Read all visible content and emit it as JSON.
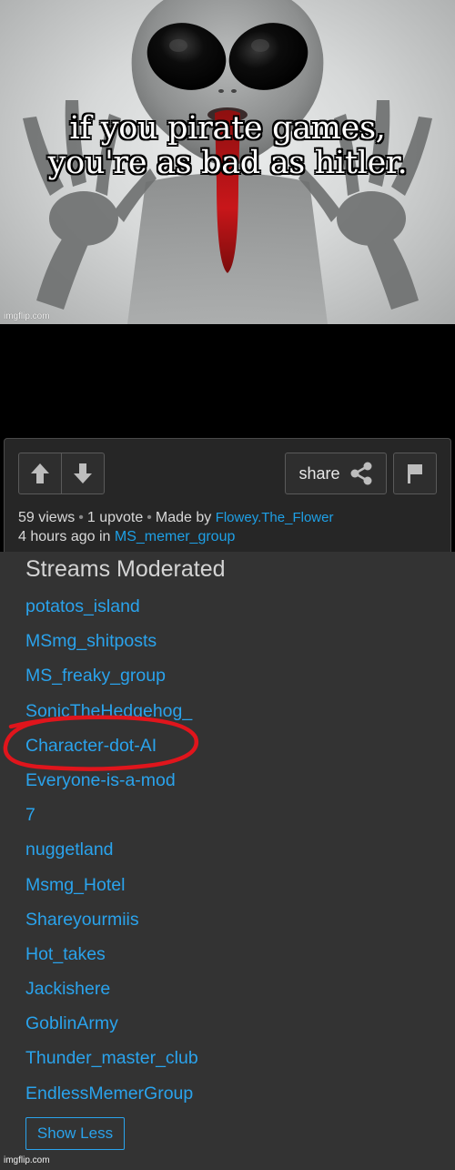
{
  "meme": {
    "caption_line1": "if you pirate games,",
    "caption_line2": "you're as bad as hitler.",
    "watermark": "imgflip.com"
  },
  "post": {
    "buttons": {
      "upvote_icon": "arrow-up-icon",
      "downvote_icon": "arrow-down-icon",
      "share_label": "share",
      "share_icon": "share-icon",
      "flag_icon": "flag-icon"
    },
    "views": "59 views",
    "upvotes": "1 upvote",
    "made_by_prefix": "Made by",
    "author": "Flowey.The_Flower",
    "time": "4 hours ago in",
    "stream": "MS_memer_group"
  },
  "streams_moderated": {
    "title": "Streams Moderated",
    "items": [
      "potatos_island",
      "MSmg_shitposts",
      "MS_freaky_group",
      "SonicTheHedgehog_",
      "Character-dot-AI",
      "Everyone-is-a-mod",
      "7",
      "nuggetland",
      "Msmg_Hotel",
      "Shareyourmiis",
      "Hot_takes",
      "Jackishere",
      "GoblinArmy",
      "Thunder_master_club",
      "EndlessMemerGroup"
    ],
    "show_less_label": "Show Less",
    "highlight_color": "#e0151c"
  },
  "bottom_watermark": "imgflip.com",
  "colors": {
    "link": "#2aa3ec",
    "panel_bg": "#333333",
    "card_bg": "#262626"
  }
}
